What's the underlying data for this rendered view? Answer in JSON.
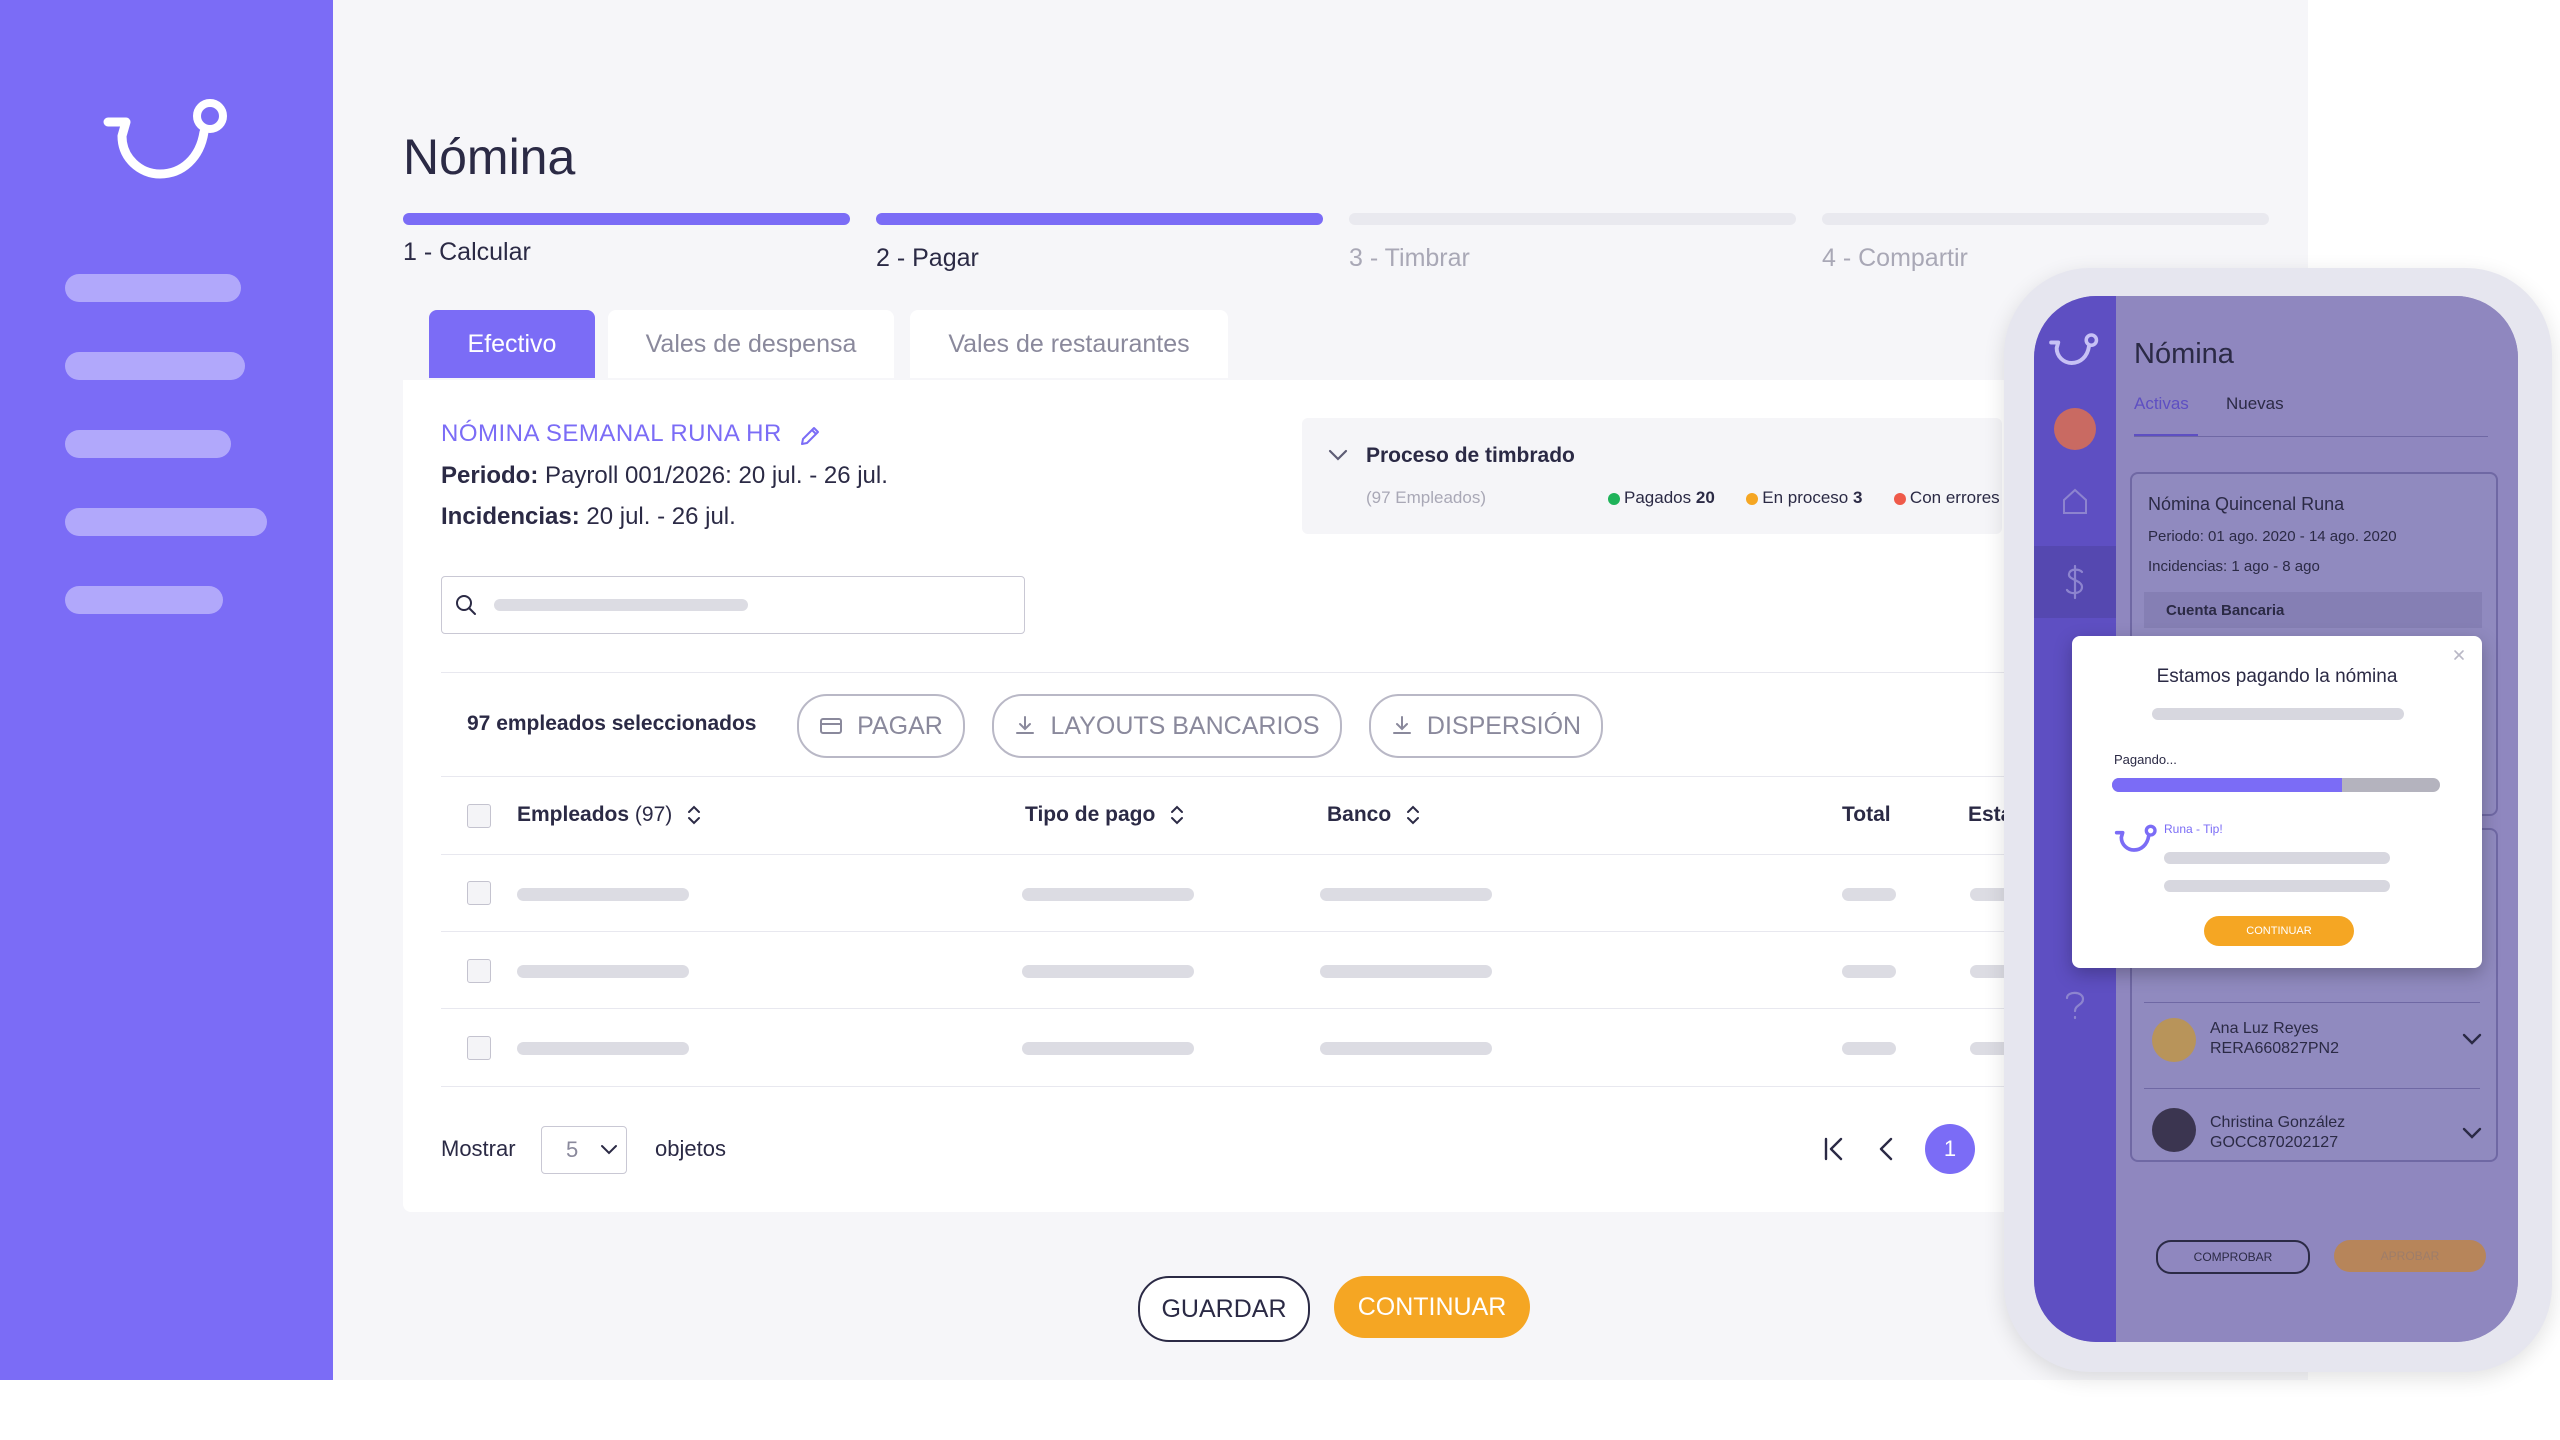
{
  "page": {
    "title": "Nómina"
  },
  "steps": [
    {
      "label": "1 - Calcular",
      "active": true
    },
    {
      "label": "2 - Pagar",
      "active": true
    },
    {
      "label": "3 - Timbrar",
      "active": false
    },
    {
      "label": "4 - Compartir",
      "active": false
    }
  ],
  "tabs": [
    "Efectivo",
    "Vales de despensa",
    "Vales de restaurantes"
  ],
  "payroll": {
    "name": "NÓMINA SEMANAL RUNA HR",
    "periodo_label": "Periodo:",
    "periodo_value": "Payroll 001/2026: 20 jul. - 26 jul.",
    "incidencias_label": "Incidencias:",
    "incidencias_value": "20 jul. - 26 jul."
  },
  "timbrado": {
    "title": "Proceso de timbrado",
    "subtitle": "(97 Empleados)",
    "pagados_label": "Pagados",
    "pagados_count": "20",
    "proceso_label": "En proceso",
    "proceso_count": "3",
    "errores_label": "Con errores"
  },
  "actions": {
    "selected": "97 empleados seleccionados",
    "pagar": "PAGAR",
    "layouts": "LAYOUTS BANCARIOS",
    "dispersion": "DISPERSIÓN"
  },
  "table": {
    "col_empleados": "Empleados",
    "col_empleados_count": "(97)",
    "col_tipo": "Tipo de pago",
    "col_banco": "Banco",
    "col_total": "Total",
    "col_estado": "Esta"
  },
  "pagination": {
    "show_label": "Mostrar",
    "page_size": "5",
    "objects_label": "objetos",
    "current_page": "1"
  },
  "footer": {
    "guardar": "GUARDAR",
    "continuar": "CONTINUAR"
  },
  "phone": {
    "title": "Nómina",
    "tab_active": "Activas",
    "tab_new": "Nuevas",
    "card_title": "Nómina Quincenal Runa",
    "card_periodo": "Periodo: 01 ago. 2020 - 14 ago. 2020",
    "card_incidencias": "Incidencias: 1 ago - 8 ago",
    "card_cuenta": "Cuenta Bancaria",
    "modal_title": "Estamos pagando la nómina",
    "modal_progress_label": "Pagando...",
    "modal_progress": 0.7,
    "modal_tip": "Runa - Tip!",
    "modal_button": "CONTINUAR",
    "employees": [
      {
        "name": "Ana Luz Reyes",
        "id": "RERA660827PN2"
      },
      {
        "name": "Christina González",
        "id": "GOCC870202127"
      }
    ],
    "btn_comprobar": "COMPROBAR",
    "btn_aprobar": "APROBAR"
  },
  "colors": {
    "brand": "#7b6cf6",
    "accent": "#f5a623",
    "dark": "#2b2a45",
    "success": "#1fb35a",
    "warning": "#f5a623",
    "error": "#ef5a4a"
  },
  "icons": [
    "runa-logo-icon",
    "pencil-icon",
    "search-icon",
    "chevron-down-icon",
    "card-icon",
    "download-icon",
    "sort-icon",
    "first-page-icon",
    "prev-page-icon",
    "home-icon",
    "dollar-icon",
    "help-icon",
    "close-icon"
  ]
}
